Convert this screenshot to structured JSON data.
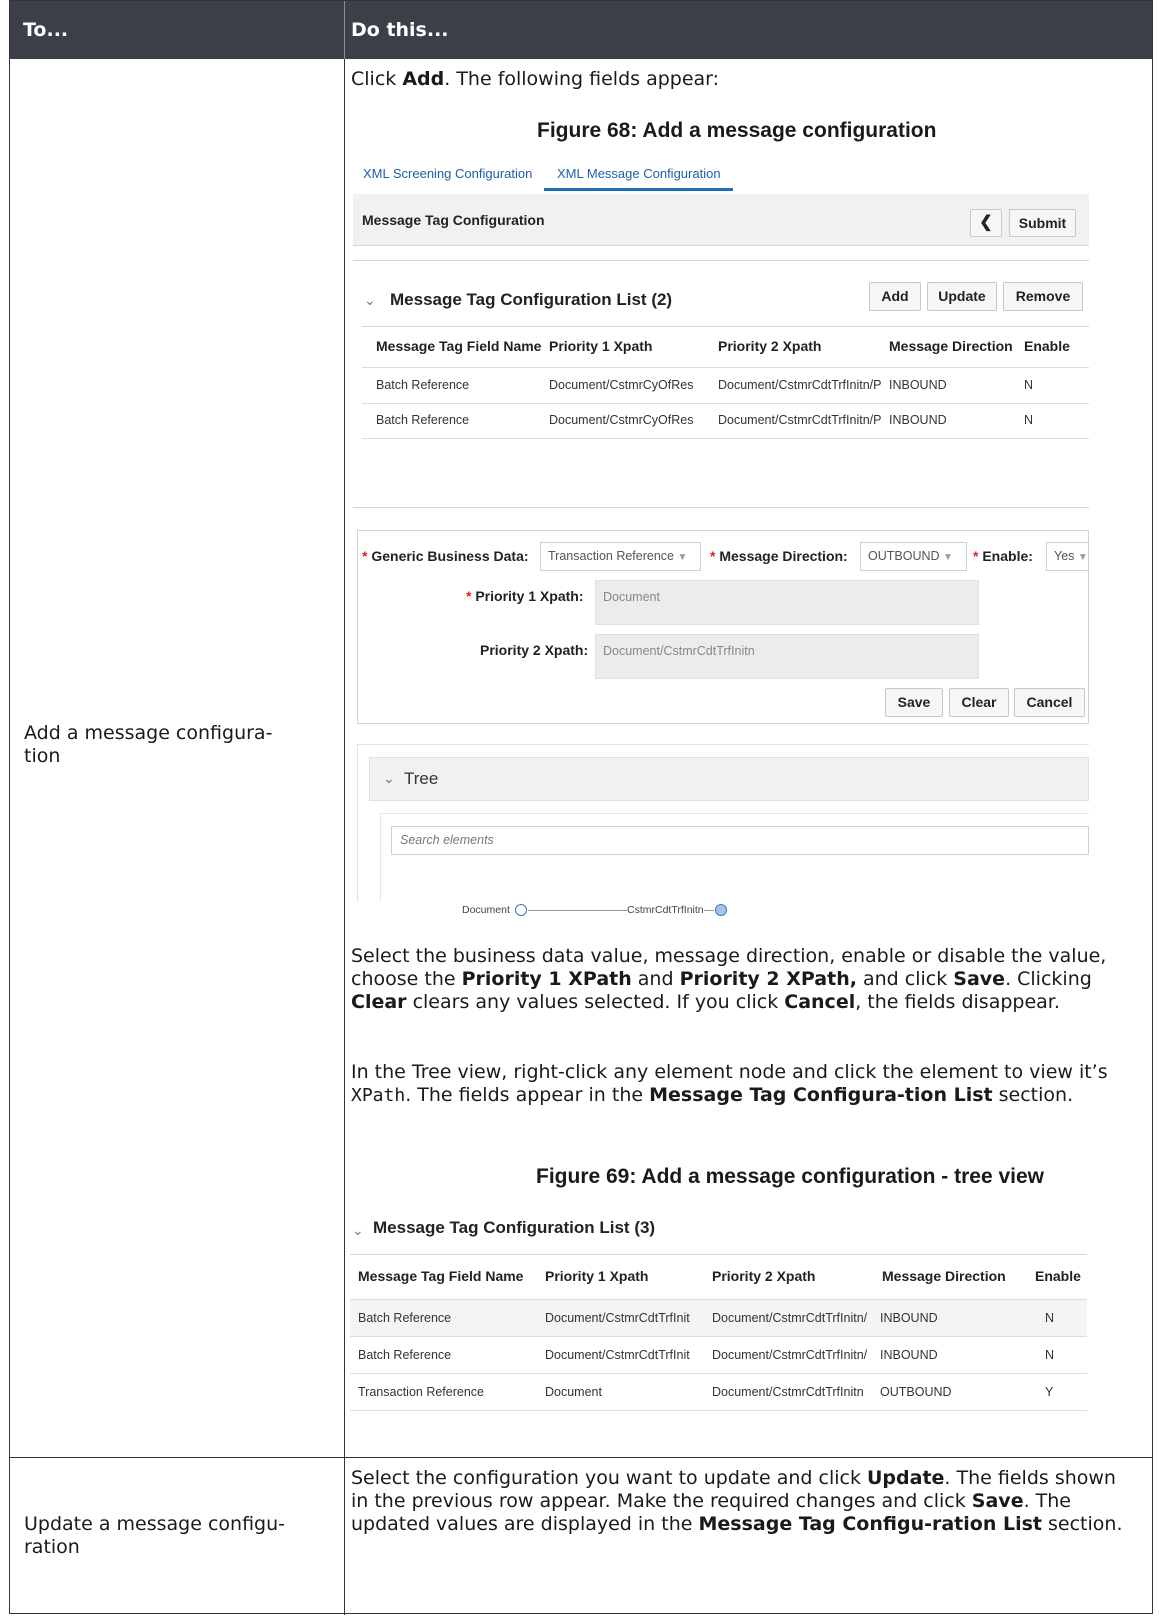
{
  "table": {
    "header_to": "To...",
    "header_do": "Do this..."
  },
  "row1": {
    "to": "Add a message configura-\ntion",
    "intro_pre": "Click ",
    "intro_bold": "Add",
    "intro_post": ". The following fields appear:",
    "figure68_caption": "Figure 68:  Add a message configuration",
    "figure69_caption": "Figure 69:  Add a message configuration - tree view"
  },
  "fig68": {
    "tabs": [
      "XML Screening Configuration",
      "XML Message Configuration"
    ],
    "bar_title": "Message Tag Configuration",
    "back_icon": "chevron-left-icon",
    "submit": "Submit",
    "list_title": "Message Tag Configuration List (2)",
    "add": "Add",
    "update": "Update",
    "remove": "Remove",
    "columns": [
      "Message Tag Field Name",
      "Priority 1 Xpath",
      "Priority 2 Xpath",
      "Message Direction",
      "Enable"
    ],
    "rows": [
      [
        "Batch Reference",
        "Document/CstmrCyOfRes",
        "Document/CstmrCdtTrfInitn/P",
        "INBOUND",
        "N"
      ],
      [
        "Batch Reference",
        "Document/CstmrCyOfRes",
        "Document/CstmrCdtTrfInitn/P",
        "INBOUND",
        "N"
      ]
    ],
    "form": {
      "generic_label": "Generic Business Data:",
      "generic_value": "Transaction Reference",
      "direction_label": "Message Direction:",
      "direction_value": "OUTBOUND",
      "enable_label": "Enable:",
      "enable_value": "Yes",
      "p1_label": "Priority 1 Xpath:",
      "p1_value": "Document",
      "p2_label": "Priority 2 Xpath:",
      "p2_value": "Document/CstmrCdtTrfInitn",
      "save": "Save",
      "clear": "Clear",
      "cancel": "Cancel",
      "required_mark": "*"
    },
    "tree": {
      "title": "Tree",
      "search_placeholder": "Search elements",
      "node1": "Document",
      "node2": "CstmrCdtTrfInitn"
    }
  },
  "para1": {
    "t1": "Select the business data value, message direction, enable or disable the value, choose the ",
    "b1": "Priority 1 XPath",
    "t2": " and ",
    "b2": "Priority 2 XPath,",
    "t3": " and click ",
    "b3": "Save",
    "t4": ". Clicking ",
    "b4": "Clear",
    "t5": " clears any values selected. If you click ",
    "b5": "Cancel",
    "t6": ", the fields disappear."
  },
  "para2": {
    "t1": "In the Tree view, right-click any element node and click the element to view it’s ",
    "code": "XPath",
    "t2": ". The fields appear in the ",
    "b1": "Message Tag Configura-tion List",
    "t3": " section."
  },
  "fig69": {
    "list_title": "Message Tag Configuration List (3)",
    "columns": [
      "Message Tag Field Name",
      "Priority 1 Xpath",
      "Priority 2 Xpath",
      "Message Direction",
      "Enable"
    ],
    "rows": [
      [
        "Batch Reference",
        "Document/CstmrCdtTrfInit",
        "Document/CstmrCdtTrfInitn/",
        "INBOUND",
        "N"
      ],
      [
        "Batch Reference",
        "Document/CstmrCdtTrfInit",
        "Document/CstmrCdtTrfInitn/",
        "INBOUND",
        "N"
      ],
      [
        "Transaction Reference",
        "Document",
        "Document/CstmrCdtTrfInitn",
        "OUTBOUND",
        "Y"
      ]
    ]
  },
  "row2": {
    "to": "Update a message configu-\nration",
    "t1": "Select the configuration you want to update and click ",
    "b1": "Update",
    "t2": ". The fields shown in the previous row appear. Make the required changes and click ",
    "b2": "Save",
    "t3": ". The updated values are displayed in the ",
    "b3": "Message Tag Configu-ration List",
    "t4": " section."
  }
}
